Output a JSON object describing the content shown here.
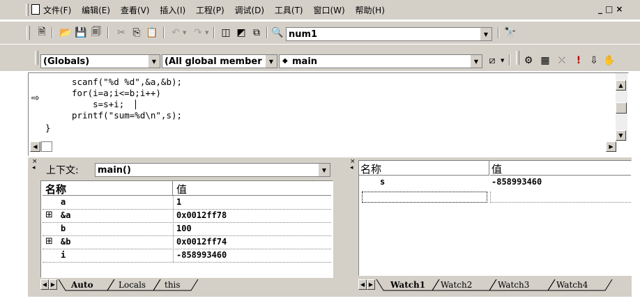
{
  "menu": [
    "文件(F)",
    "编辑(E)",
    "查看(V)",
    "插入(I)",
    "工程(P)",
    "调试(D)",
    "工具(T)",
    "窗口(W)",
    "帮助(H)"
  ],
  "window_controls": [
    "_",
    "□",
    "×"
  ],
  "toolbar1": {
    "target_value": "num1"
  },
  "toolbar2": {
    "scope_value": "(Globals)",
    "members_value": "(All global members",
    "function_value": "main"
  },
  "editor": {
    "lines": [
      "scanf(\"%d %d\",&a,&b);",
      "for(i=a;i<=b;i++)",
      "    s=s+i;",
      "printf(\"sum=%d\\n\",s);",
      "}"
    ]
  },
  "variables": {
    "context_label": "上下文:",
    "context_value": "main()",
    "col_name": "名称",
    "col_value": "值",
    "rows": [
      {
        "expand": "",
        "name": "a",
        "value": "1"
      },
      {
        "expand": "⊞",
        "name": "&a",
        "value": "0x0012ff78"
      },
      {
        "expand": "",
        "name": "b",
        "value": "100"
      },
      {
        "expand": "⊞",
        "name": "&b",
        "value": "0x0012ff74"
      },
      {
        "expand": "",
        "name": "i",
        "value": "-858993460"
      }
    ],
    "tabs": [
      "Auto",
      "Locals",
      "this"
    ]
  },
  "watch": {
    "col_name": "名称",
    "col_value": "值",
    "rows": [
      {
        "name": "s",
        "value": "-858993460"
      }
    ],
    "tabs": [
      "Watch1",
      "Watch2",
      "Watch3",
      "Watch4"
    ]
  }
}
